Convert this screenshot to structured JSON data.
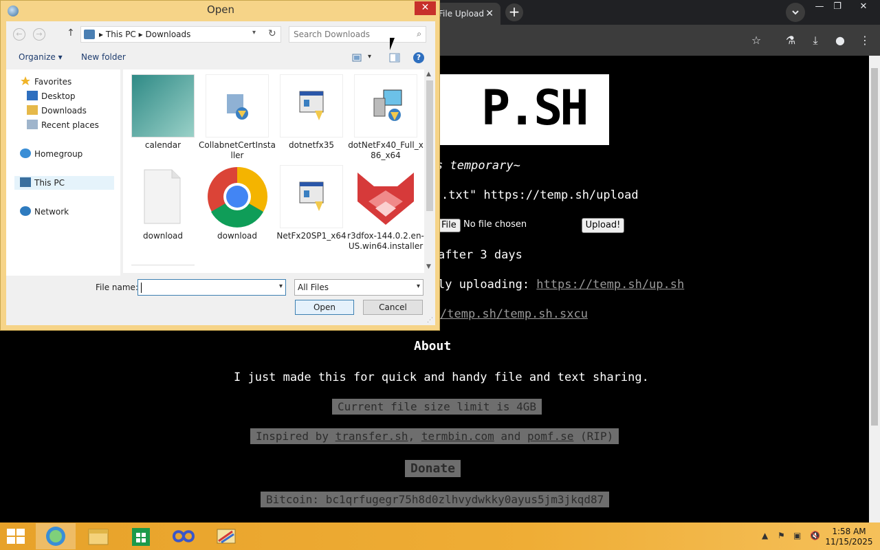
{
  "browser": {
    "tab_title": "File Upload",
    "tab_close": "✕",
    "new_tab": "+",
    "window": {
      "minimize": "—",
      "restore": "❐",
      "close": "✕"
    }
  },
  "site": {
    "logo_text": "P.SH",
    "tagline": "s temporary~",
    "curl_line": ".txt\" https://temp.sh/upload",
    "file_button": "File",
    "no_file": "No file chosen",
    "upload_button": "Upload!",
    "expire_line": "after 3 days",
    "uploading_prefix": "ly uploading: ",
    "uploading_link": "https://temp.sh/up.sh",
    "sxcu_link": "/temp.sh/temp.sh.sxcu",
    "about_heading": "About",
    "about_text": "I just made this for quick and handy file and text sharing.",
    "size_limit": "Current file size limit is 4GB",
    "inspired_prefix": "Inspired by ",
    "inspired_link1": "transfer.sh",
    "inspired_sep1": ", ",
    "inspired_link2": "termbin.com",
    "inspired_sep2": " and ",
    "inspired_link3": "pomf.se",
    "inspired_suffix": " (RIP)",
    "donate": "Donate",
    "bitcoin": "Bitcoin: bc1qrfugegr75h8d0zlhvydwkky0ayus5jm3jkqd87"
  },
  "dialog": {
    "title": "Open",
    "close": "✕",
    "nav_back": "←",
    "nav_forward": "→",
    "nav_up": "↑",
    "breadcrumb": [
      "This PC",
      "Downloads"
    ],
    "breadcrumb_sep": "▸",
    "search_placeholder": "Search Downloads",
    "organize": "Organize ▾",
    "new_folder": "New folder",
    "help": "?",
    "nav_pane": {
      "favorites": "Favorites",
      "desktop": "Desktop",
      "downloads": "Downloads",
      "recent": "Recent places",
      "homegroup": "Homegroup",
      "this_pc": "This PC",
      "network": "Network"
    },
    "files": [
      {
        "name": "calendar"
      },
      {
        "name": "CollabnetCertInstaller"
      },
      {
        "name": "dotnetfx35"
      },
      {
        "name": "dotNetFx40_Full_x86_x64"
      },
      {
        "name": "download"
      },
      {
        "name": "download"
      },
      {
        "name": "NetFx20SP1_x64"
      },
      {
        "name": "r3dfox-144.0.2.en-US.win64.installer"
      }
    ],
    "file_name_label": "File name:",
    "file_name_value": "",
    "file_type": "All Files",
    "open_button": "Open",
    "cancel_button": "Cancel"
  },
  "taskbar": {
    "clock_time": "1:58 AM",
    "clock_date": "11/15/2025"
  },
  "colors": {
    "dialog_frame": "#f6d488",
    "taskbar": "#efad35",
    "close_red": "#c7302b"
  }
}
